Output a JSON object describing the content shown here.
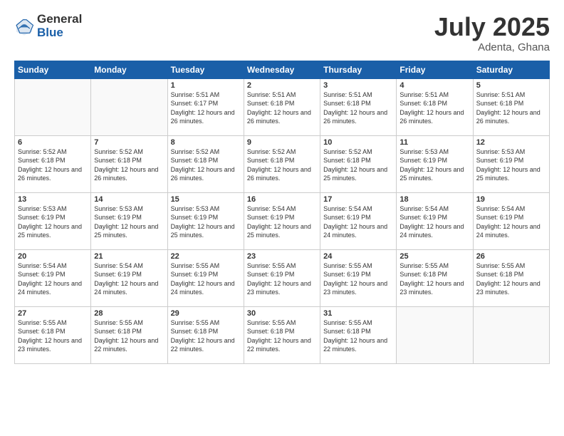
{
  "logo": {
    "general": "General",
    "blue": "Blue"
  },
  "header": {
    "month_year": "July 2025",
    "location": "Adenta, Ghana"
  },
  "days_of_week": [
    "Sunday",
    "Monday",
    "Tuesday",
    "Wednesday",
    "Thursday",
    "Friday",
    "Saturday"
  ],
  "weeks": [
    [
      {
        "day": "",
        "info": ""
      },
      {
        "day": "",
        "info": ""
      },
      {
        "day": "1",
        "info": "Sunrise: 5:51 AM\nSunset: 6:17 PM\nDaylight: 12 hours and 26 minutes."
      },
      {
        "day": "2",
        "info": "Sunrise: 5:51 AM\nSunset: 6:18 PM\nDaylight: 12 hours and 26 minutes."
      },
      {
        "day": "3",
        "info": "Sunrise: 5:51 AM\nSunset: 6:18 PM\nDaylight: 12 hours and 26 minutes."
      },
      {
        "day": "4",
        "info": "Sunrise: 5:51 AM\nSunset: 6:18 PM\nDaylight: 12 hours and 26 minutes."
      },
      {
        "day": "5",
        "info": "Sunrise: 5:51 AM\nSunset: 6:18 PM\nDaylight: 12 hours and 26 minutes."
      }
    ],
    [
      {
        "day": "6",
        "info": "Sunrise: 5:52 AM\nSunset: 6:18 PM\nDaylight: 12 hours and 26 minutes."
      },
      {
        "day": "7",
        "info": "Sunrise: 5:52 AM\nSunset: 6:18 PM\nDaylight: 12 hours and 26 minutes."
      },
      {
        "day": "8",
        "info": "Sunrise: 5:52 AM\nSunset: 6:18 PM\nDaylight: 12 hours and 26 minutes."
      },
      {
        "day": "9",
        "info": "Sunrise: 5:52 AM\nSunset: 6:18 PM\nDaylight: 12 hours and 26 minutes."
      },
      {
        "day": "10",
        "info": "Sunrise: 5:52 AM\nSunset: 6:18 PM\nDaylight: 12 hours and 25 minutes."
      },
      {
        "day": "11",
        "info": "Sunrise: 5:53 AM\nSunset: 6:19 PM\nDaylight: 12 hours and 25 minutes."
      },
      {
        "day": "12",
        "info": "Sunrise: 5:53 AM\nSunset: 6:19 PM\nDaylight: 12 hours and 25 minutes."
      }
    ],
    [
      {
        "day": "13",
        "info": "Sunrise: 5:53 AM\nSunset: 6:19 PM\nDaylight: 12 hours and 25 minutes."
      },
      {
        "day": "14",
        "info": "Sunrise: 5:53 AM\nSunset: 6:19 PM\nDaylight: 12 hours and 25 minutes."
      },
      {
        "day": "15",
        "info": "Sunrise: 5:53 AM\nSunset: 6:19 PM\nDaylight: 12 hours and 25 minutes."
      },
      {
        "day": "16",
        "info": "Sunrise: 5:54 AM\nSunset: 6:19 PM\nDaylight: 12 hours and 25 minutes."
      },
      {
        "day": "17",
        "info": "Sunrise: 5:54 AM\nSunset: 6:19 PM\nDaylight: 12 hours and 24 minutes."
      },
      {
        "day": "18",
        "info": "Sunrise: 5:54 AM\nSunset: 6:19 PM\nDaylight: 12 hours and 24 minutes."
      },
      {
        "day": "19",
        "info": "Sunrise: 5:54 AM\nSunset: 6:19 PM\nDaylight: 12 hours and 24 minutes."
      }
    ],
    [
      {
        "day": "20",
        "info": "Sunrise: 5:54 AM\nSunset: 6:19 PM\nDaylight: 12 hours and 24 minutes."
      },
      {
        "day": "21",
        "info": "Sunrise: 5:54 AM\nSunset: 6:19 PM\nDaylight: 12 hours and 24 minutes."
      },
      {
        "day": "22",
        "info": "Sunrise: 5:55 AM\nSunset: 6:19 PM\nDaylight: 12 hours and 24 minutes."
      },
      {
        "day": "23",
        "info": "Sunrise: 5:55 AM\nSunset: 6:19 PM\nDaylight: 12 hours and 23 minutes."
      },
      {
        "day": "24",
        "info": "Sunrise: 5:55 AM\nSunset: 6:19 PM\nDaylight: 12 hours and 23 minutes."
      },
      {
        "day": "25",
        "info": "Sunrise: 5:55 AM\nSunset: 6:18 PM\nDaylight: 12 hours and 23 minutes."
      },
      {
        "day": "26",
        "info": "Sunrise: 5:55 AM\nSunset: 6:18 PM\nDaylight: 12 hours and 23 minutes."
      }
    ],
    [
      {
        "day": "27",
        "info": "Sunrise: 5:55 AM\nSunset: 6:18 PM\nDaylight: 12 hours and 23 minutes."
      },
      {
        "day": "28",
        "info": "Sunrise: 5:55 AM\nSunset: 6:18 PM\nDaylight: 12 hours and 22 minutes."
      },
      {
        "day": "29",
        "info": "Sunrise: 5:55 AM\nSunset: 6:18 PM\nDaylight: 12 hours and 22 minutes."
      },
      {
        "day": "30",
        "info": "Sunrise: 5:55 AM\nSunset: 6:18 PM\nDaylight: 12 hours and 22 minutes."
      },
      {
        "day": "31",
        "info": "Sunrise: 5:55 AM\nSunset: 6:18 PM\nDaylight: 12 hours and 22 minutes."
      },
      {
        "day": "",
        "info": ""
      },
      {
        "day": "",
        "info": ""
      }
    ]
  ]
}
